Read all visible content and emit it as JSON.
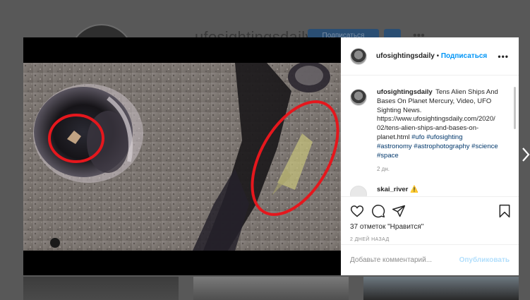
{
  "background": {
    "profile_username": "ufosightingsdaily",
    "follow_label": "Подписаться"
  },
  "post": {
    "username": "ufosightingsdaily",
    "separator": "•",
    "follow_label": "Подписаться",
    "more_icon": "ellipsis-icon",
    "caption": {
      "username": "ufosightingsdaily",
      "text": "Tens Alien Ships And Bases On Planet Mercury, Video, UFO Sighting News. https://www.ufosightingsdaily.com/2020/02/tens-alien-ships-and-bases-on-planet.html",
      "hashtags": [
        "#ufo",
        "#ufosighting",
        "#astronomy",
        "#astrophotography",
        "#science",
        "#space"
      ],
      "ago": "2 дн."
    },
    "next_comment_user": "skai_river ⚠️",
    "likes": "37 отметок \"Нравится\"",
    "timestamp": "2 ДНЕЙ НАЗАД",
    "comment_placeholder": "Добавьте комментарий...",
    "publish_label": "Опубликовать",
    "icons": [
      "heart-icon",
      "comment-icon",
      "share-icon",
      "bookmark-icon"
    ],
    "next_arrow_icon": "chevron-right-icon"
  }
}
